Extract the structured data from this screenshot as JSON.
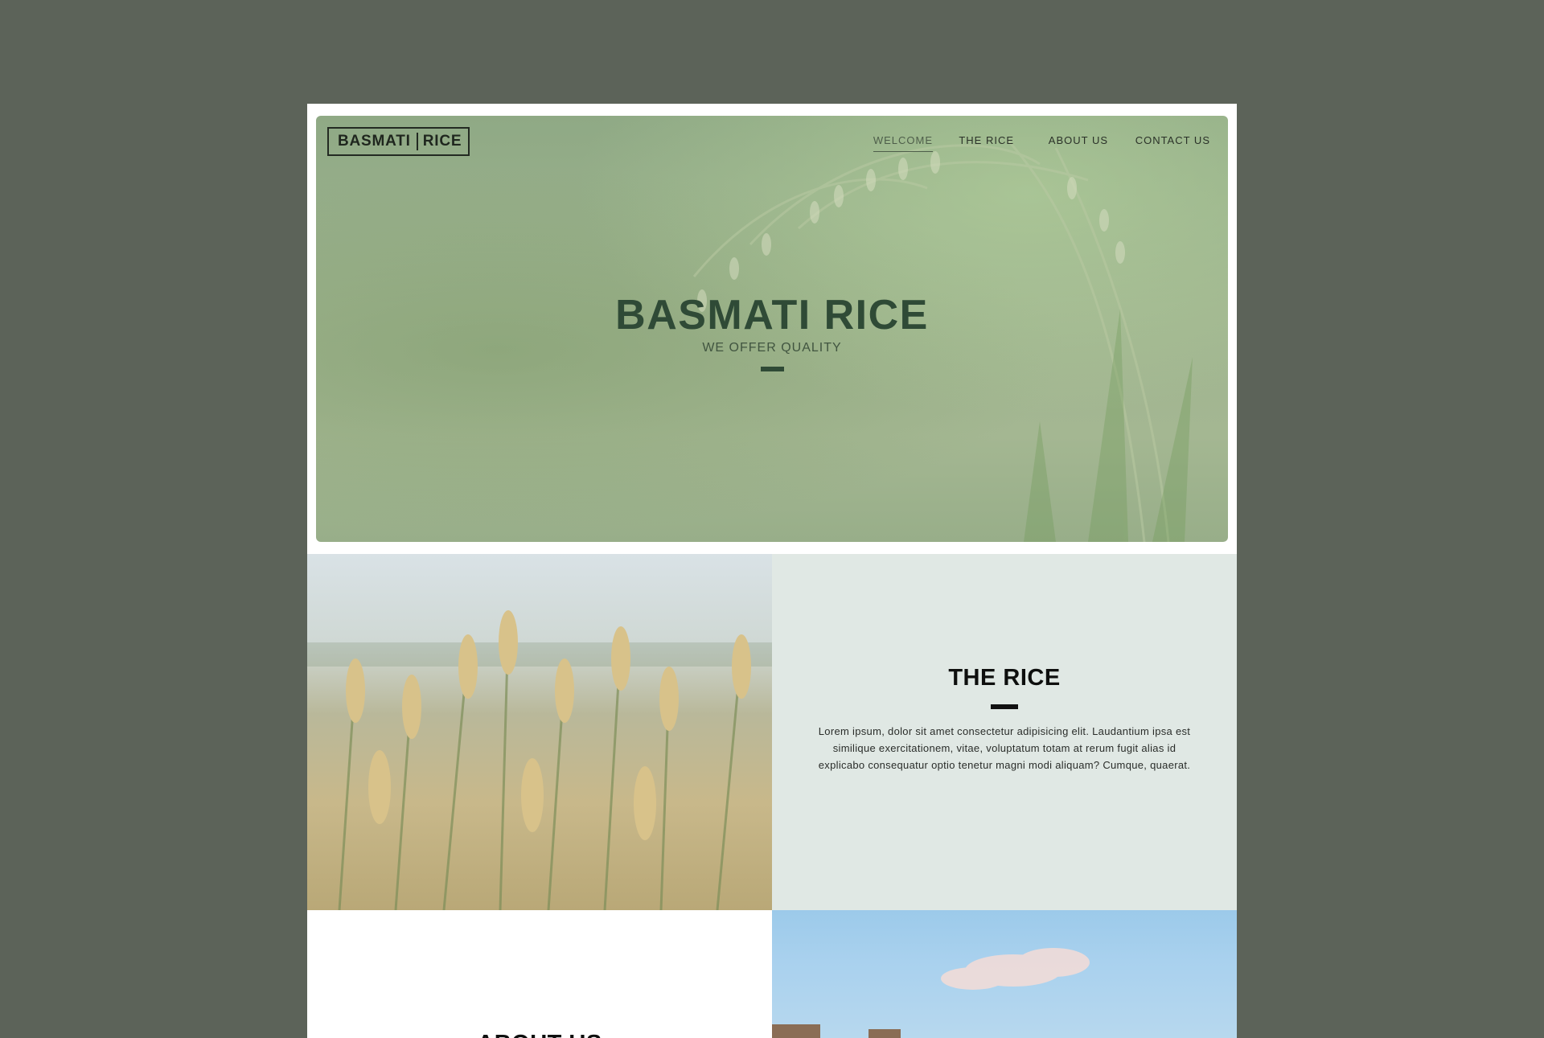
{
  "brand": {
    "left": "BASMATI",
    "right": "RICE"
  },
  "nav": {
    "items": [
      {
        "label": "WELCOME",
        "active": true
      },
      {
        "label": "THE RICE",
        "active": false
      },
      {
        "label": "ABOUT US",
        "active": false
      },
      {
        "label": "CONTACT US",
        "active": false
      }
    ]
  },
  "hero": {
    "title": "BASMATI RICE",
    "subtitle": "WE OFFER QUALITY"
  },
  "rice_section": {
    "title": "THE RICE",
    "body": "Lorem ipsum, dolor sit amet consectetur adipisicing elit. Laudantium ipsa est similique exercitationem, vitae, voluptatum totam at rerum fugit alias id explicabo consequatur optio tenetur magni modi aliquam? Cumque, quaerat."
  },
  "about_section": {
    "title": "ABOUT US"
  },
  "colors": {
    "outer_background": "#5c6359",
    "hero_title": "#2f4a36",
    "rice_panel": "#e0e8e4",
    "text_dark": "#0e0f0e"
  }
}
